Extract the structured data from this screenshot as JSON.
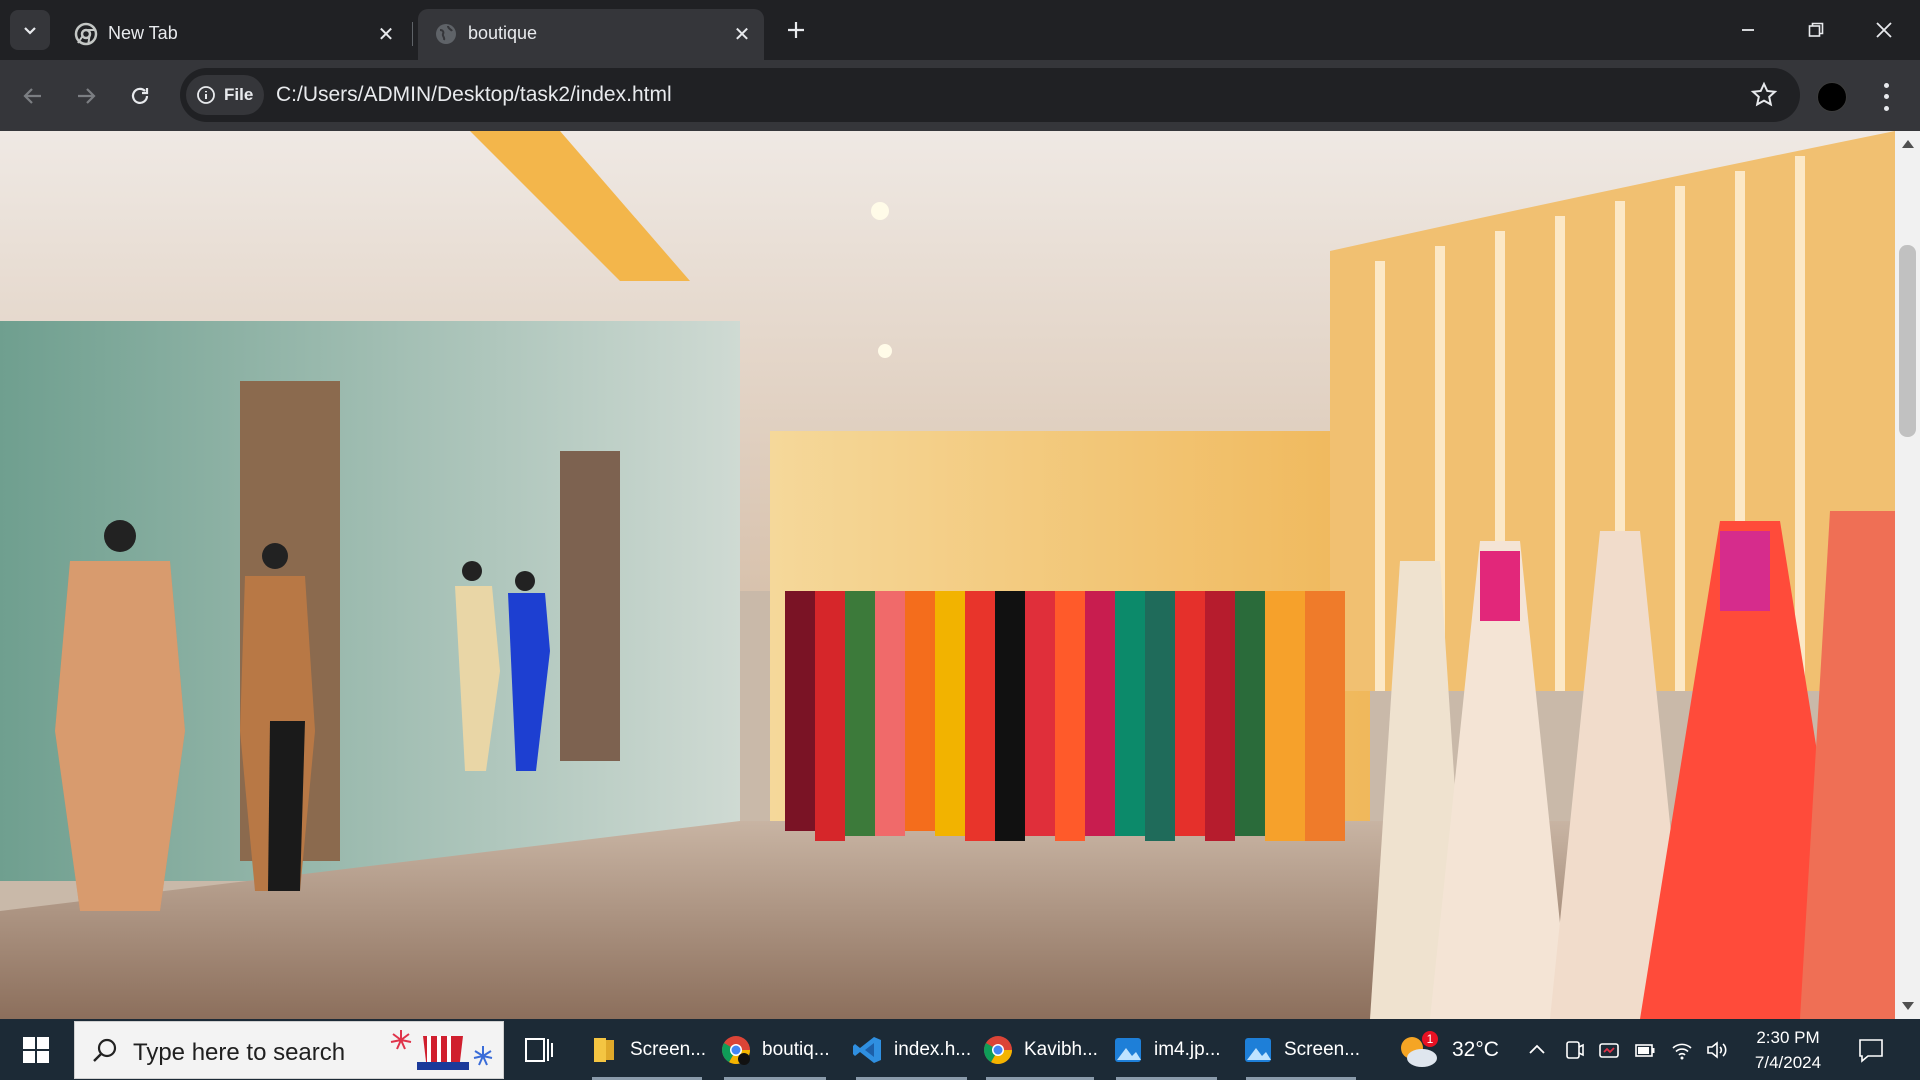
{
  "browser": {
    "tabs": [
      {
        "title": "New Tab",
        "active": false
      },
      {
        "title": "boutique",
        "active": true
      }
    ],
    "site_chip_label": "File",
    "url": "C:/Users/ADMIN/Desktop/task2/index.html"
  },
  "page": {
    "hero_image": "boutique store interior with mannequins and colorful dresses on racks"
  },
  "taskbar": {
    "search_placeholder": "Type here to search",
    "apps": [
      {
        "label": "Screen...",
        "icon": "file-explorer-icon"
      },
      {
        "label": "boutiq...",
        "icon": "chrome-icon"
      },
      {
        "label": "index.h...",
        "icon": "vscode-icon"
      },
      {
        "label": "Kavibh...",
        "icon": "chrome-icon"
      },
      {
        "label": "im4.jp...",
        "icon": "photos-icon"
      },
      {
        "label": "Screen...",
        "icon": "photos-icon"
      }
    ],
    "weather": {
      "temp": "32°C",
      "badge": "1"
    },
    "clock": {
      "time": "2:30 PM",
      "date": "7/4/2024"
    }
  },
  "colors": {
    "tabstrip": "#202124",
    "toolbar": "#35363a",
    "taskbar": "#1c2a36"
  }
}
